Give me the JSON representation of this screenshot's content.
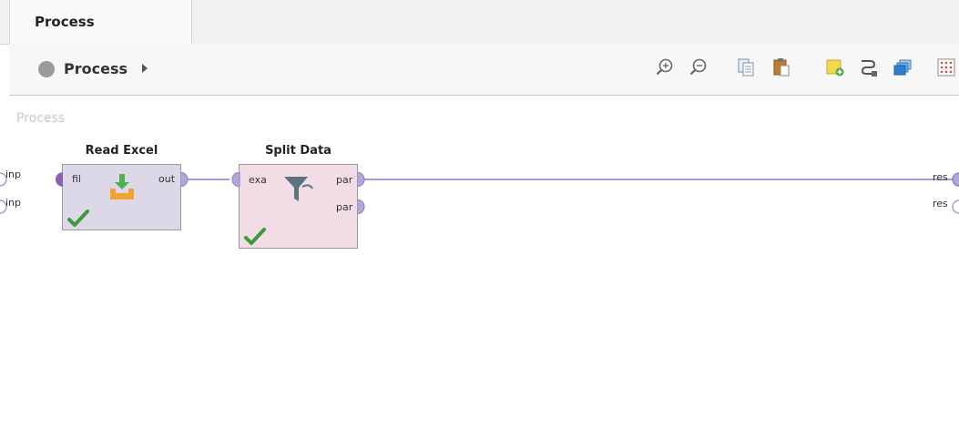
{
  "tab": {
    "label": "Process"
  },
  "breadcrumb": {
    "label": "Process"
  },
  "toolbar": {
    "buttons": [
      {
        "icon": "zoom-in-icon"
      },
      {
        "icon": "zoom-out-icon"
      },
      {
        "icon": "copy-icon"
      },
      {
        "icon": "paste-icon"
      },
      {
        "icon": "add-note-icon"
      },
      {
        "icon": "auto-wire-icon"
      },
      {
        "icon": "layers-icon"
      },
      {
        "icon": "grid-icon"
      }
    ]
  },
  "canvas": {
    "title": "Process",
    "left_ports": [
      "inp",
      "inp"
    ],
    "right_ports": [
      "res",
      "res"
    ],
    "operators": [
      {
        "name": "Read Excel",
        "color": "#dcd8e8",
        "inputs": [
          "fil"
        ],
        "outputs": [
          "out"
        ],
        "icon": "read-excel-icon",
        "status": "ok"
      },
      {
        "name": "Split Data",
        "color": "#f2dde6",
        "inputs": [
          "exa"
        ],
        "outputs": [
          "par",
          "par"
        ],
        "icon": "filter-icon",
        "status": "ok"
      }
    ]
  },
  "colors": {
    "port": "#b3a7d8",
    "wire": "#a99ad6",
    "check": "#3c9a3c"
  }
}
